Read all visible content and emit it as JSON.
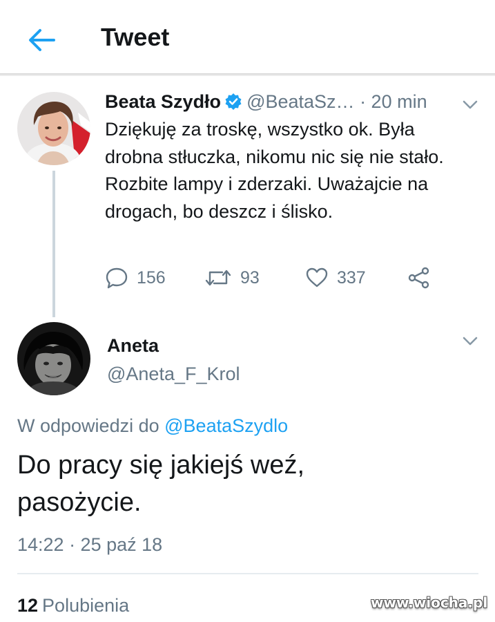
{
  "header": {
    "title": "Tweet",
    "back_icon": "arrow-left-icon",
    "accent": "#1da1f2"
  },
  "parent_tweet": {
    "author_name": "Beata Szydło",
    "verified_icon": "verified-badge-icon",
    "handle": "@BeataSz…",
    "time": "· 20 min",
    "text": "Dziękuję za troskę, wszystko ok. Była drobna stłuczka, nikomu nic się nie stało. Rozbite lampy i zderzaki. Uważajcie na drogach, bo deszcz i ślisko.",
    "replies": "156",
    "retweets": "93",
    "likes": "337"
  },
  "reply": {
    "author_name": "Aneta",
    "handle": "@Aneta_F_Krol",
    "in_reply_prefix": "W odpowiedzi do",
    "in_reply_to": "@BeataSzydlo",
    "text": "Do pracy się jakiejś weź, pasożycie.",
    "timestamp": "14:22 · 25 paź 18",
    "likes_count": "12",
    "likes_label": "Polubienia"
  },
  "watermark": "www.wiocha.pl",
  "colors": {
    "text": "#14171a",
    "secondary": "#657786",
    "link": "#1da1f2",
    "verified": "#1da1f2",
    "divider": "#e6ecf0"
  }
}
